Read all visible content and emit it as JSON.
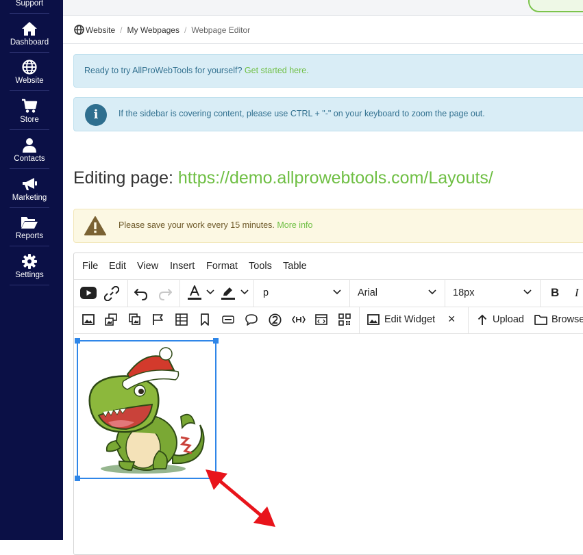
{
  "sidebar": {
    "items": [
      {
        "label": "Support",
        "icon": "support-icon"
      },
      {
        "label": "Dashboard",
        "icon": "home-icon"
      },
      {
        "label": "Website",
        "icon": "globe-icon"
      },
      {
        "label": "Store",
        "icon": "cart-icon"
      },
      {
        "label": "Contacts",
        "icon": "user-icon"
      },
      {
        "label": "Marketing",
        "icon": "megaphone-icon"
      },
      {
        "label": "Reports",
        "icon": "folder-open-icon"
      },
      {
        "label": "Settings",
        "icon": "gear-icon"
      }
    ]
  },
  "breadcrumb": {
    "items": [
      "Website",
      "My Webpages",
      "Webpage Editor"
    ],
    "separator": "/"
  },
  "alerts": {
    "trial": {
      "text": "Ready to try AllProWebTools for yourself? ",
      "link": "Get started here."
    },
    "sidebar_tip": {
      "text": "If the sidebar is covering content, please use CTRL + \"-\" on your keyboard to zoom the page out.",
      "icon_char": "i"
    },
    "save_warning": {
      "text": "Please save your work every 15 minutes. ",
      "link": "More info"
    }
  },
  "heading": {
    "prefix": "Editing page: ",
    "url": "https://demo.allprowebtools.com/Layouts/"
  },
  "editor": {
    "menu": [
      "File",
      "Edit",
      "View",
      "Insert",
      "Format",
      "Tools",
      "Table"
    ],
    "toolbar": {
      "block_format": "p",
      "font_family": "Arial",
      "font_size": "18px",
      "bold": "B",
      "italic": "I"
    },
    "toolbar2": {
      "edit_widget": "Edit Widget",
      "upload": "Upload",
      "browse": "Browse",
      "close": "×"
    }
  },
  "colors": {
    "sidebar_bg": "#0b1046",
    "link_green": "#6fbf44",
    "info_bg": "#d9edf6",
    "warning_bg": "#fcf8e3",
    "selection_blue": "#2f86e8",
    "arrow_red": "#e8141b"
  }
}
